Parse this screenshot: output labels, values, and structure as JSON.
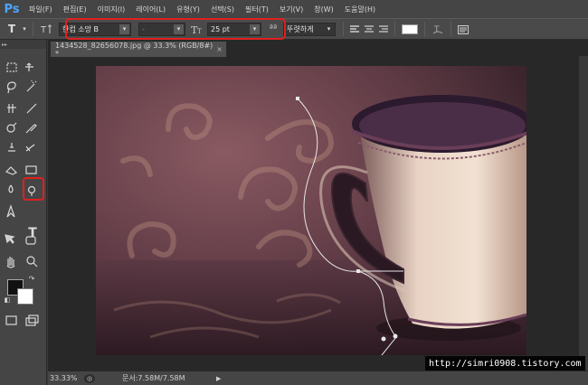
{
  "app": {
    "logo": "Ps"
  },
  "menu": [
    "파일(F)",
    "편집(E)",
    "이미지(I)",
    "레이어(L)",
    "유형(Y)",
    "선택(S)",
    "필터(T)",
    "보기(V)",
    "창(W)",
    "도움말(H)"
  ],
  "options": {
    "tool_glyph": "T",
    "font_family": "한컴 소망 B",
    "font_style": "-",
    "font_size": "25 pt",
    "antialias": "뚜렷하게"
  },
  "document": {
    "tab_title": "1434528_82656078.jpg @ 33.3% (RGB/8#) *",
    "tab_close": "×"
  },
  "status": {
    "zoom": "33.33%",
    "doc_info": "문서:7.58M/7.58M",
    "arrow": "▶"
  },
  "watermark": {
    "text": "http://simri0908.tistory.com"
  },
  "colors": {
    "accent_highlight": "#e02020",
    "panel": "#454545",
    "canvas_bg": "#282828"
  },
  "icons": [
    "move-icon",
    "marquee-icon",
    "lasso-icon",
    "magic-wand-icon",
    "crop-icon",
    "eyedropper-icon",
    "healing-icon",
    "brush-icon",
    "stamp-icon",
    "history-brush-icon",
    "eraser-icon",
    "gradient-icon",
    "blur-icon",
    "dodge-icon",
    "pen-icon",
    "type-icon",
    "path-select-icon",
    "shape-icon",
    "hand-icon",
    "zoom-icon"
  ]
}
